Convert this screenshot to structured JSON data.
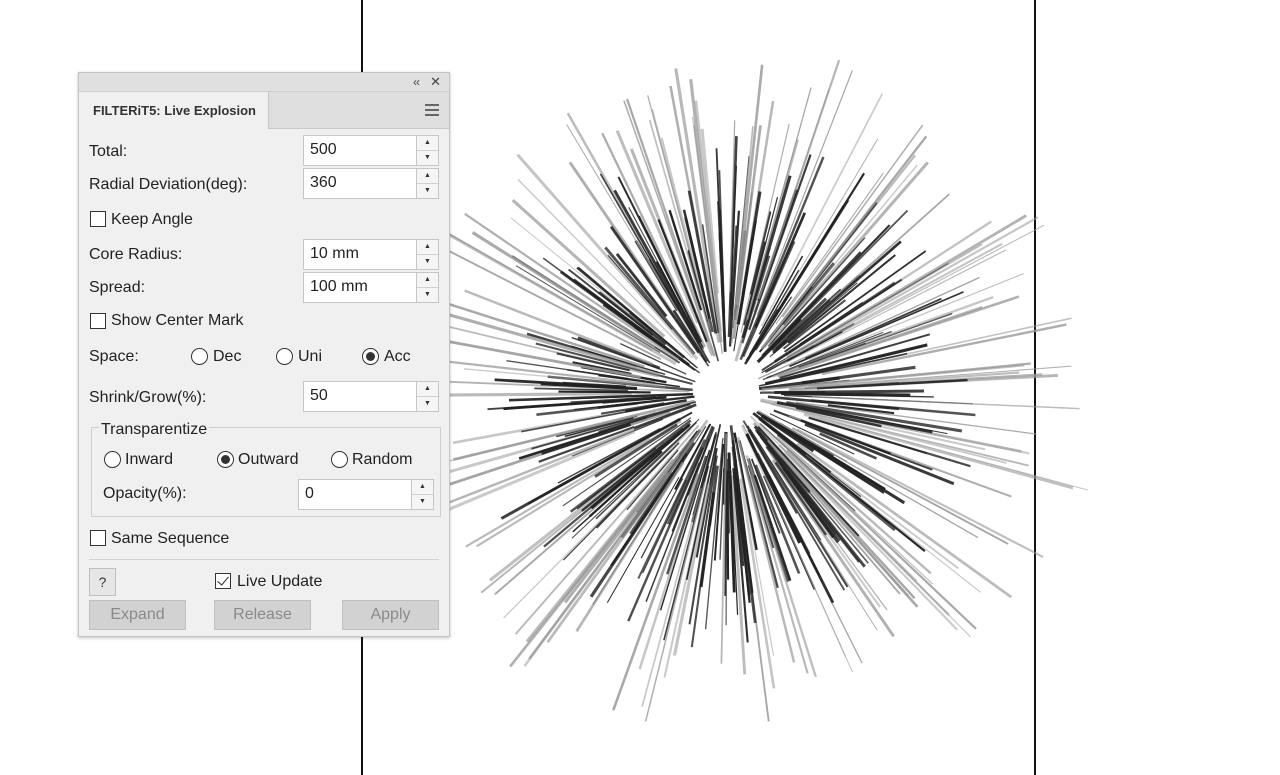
{
  "panel": {
    "tab_title": "FILTERiT5: Live Explosion",
    "collapse_glyph": "‹‹",
    "close_glyph": "✕"
  },
  "fields": {
    "total": {
      "label": "Total:",
      "value": "500"
    },
    "radial_deviation": {
      "label": "Radial Deviation(deg):",
      "value": "360"
    },
    "keep_angle": {
      "label": "Keep Angle",
      "checked": false
    },
    "core_radius": {
      "label": "Core Radius:",
      "value": "10 mm"
    },
    "spread": {
      "label": "Spread:",
      "value": "100 mm"
    },
    "show_center_mark": {
      "label": "Show Center Mark",
      "checked": false
    },
    "space": {
      "label": "Space:",
      "options": [
        "Dec",
        "Uni",
        "Acc"
      ],
      "selected": "Acc"
    },
    "shrink_grow": {
      "label": "Shrink/Grow(%):",
      "value": "50"
    }
  },
  "transparentize": {
    "title": "Transparentize",
    "options": [
      "Inward",
      "Outward",
      "Random"
    ],
    "selected": "Outward",
    "opacity_label": "Opacity(%):",
    "opacity_value": "0"
  },
  "same_sequence": {
    "label": "Same Sequence",
    "checked": false
  },
  "footer": {
    "help_label": "?",
    "live_update_label": "Live Update",
    "live_update_checked": true,
    "expand_label": "Expand",
    "release_label": "Release",
    "apply_label": "Apply"
  },
  "icons": [
    "collapse-icon",
    "close-icon",
    "panel-menu-icon",
    "spin-up-icon",
    "spin-down-icon"
  ],
  "colors": {
    "panel_bg": "#f0f0f0",
    "ray_dark": "#222222",
    "ray_light": "#9a9a9a",
    "artboard_edge": "#111111"
  }
}
